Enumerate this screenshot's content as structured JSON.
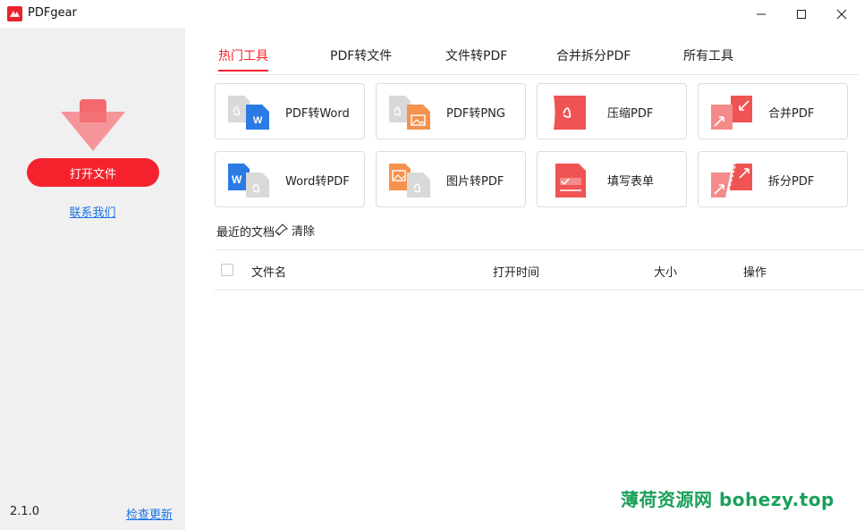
{
  "app": {
    "title": "PDFgear"
  },
  "sidebar": {
    "open_button": "打开文件",
    "contact_link": "联系我们",
    "version": "2.1.0",
    "update_link": "检查更新"
  },
  "tabs": [
    {
      "label": "热门工具",
      "active": true
    },
    {
      "label": "PDF转文件",
      "active": false
    },
    {
      "label": "文件转PDF",
      "active": false
    },
    {
      "label": "合并拆分PDF",
      "active": false
    },
    {
      "label": "所有工具",
      "active": false
    }
  ],
  "tools": [
    {
      "label": "PDF转Word",
      "icon": "pdf-to-word-icon"
    },
    {
      "label": "PDF转PNG",
      "icon": "pdf-to-png-icon"
    },
    {
      "label": "压缩PDF",
      "icon": "compress-pdf-icon"
    },
    {
      "label": "合并PDF",
      "icon": "merge-pdf-icon"
    },
    {
      "label": "Word转PDF",
      "icon": "word-to-pdf-icon"
    },
    {
      "label": "图片转PDF",
      "icon": "image-to-pdf-icon"
    },
    {
      "label": "填写表单",
      "icon": "fill-form-icon"
    },
    {
      "label": "拆分PDF",
      "icon": "split-pdf-icon"
    }
  ],
  "recent": {
    "title": "最近的文档",
    "clear": "清除",
    "columns": {
      "name": "文件名",
      "opened": "打开时间",
      "size": "大小",
      "action": "操作"
    },
    "rows": []
  },
  "watermark": "薄荷资源网  bohezy.top",
  "colors": {
    "accent": "#f5222d",
    "sidebar_bg": "#f0f0f0",
    "link": "#1a73e8"
  }
}
